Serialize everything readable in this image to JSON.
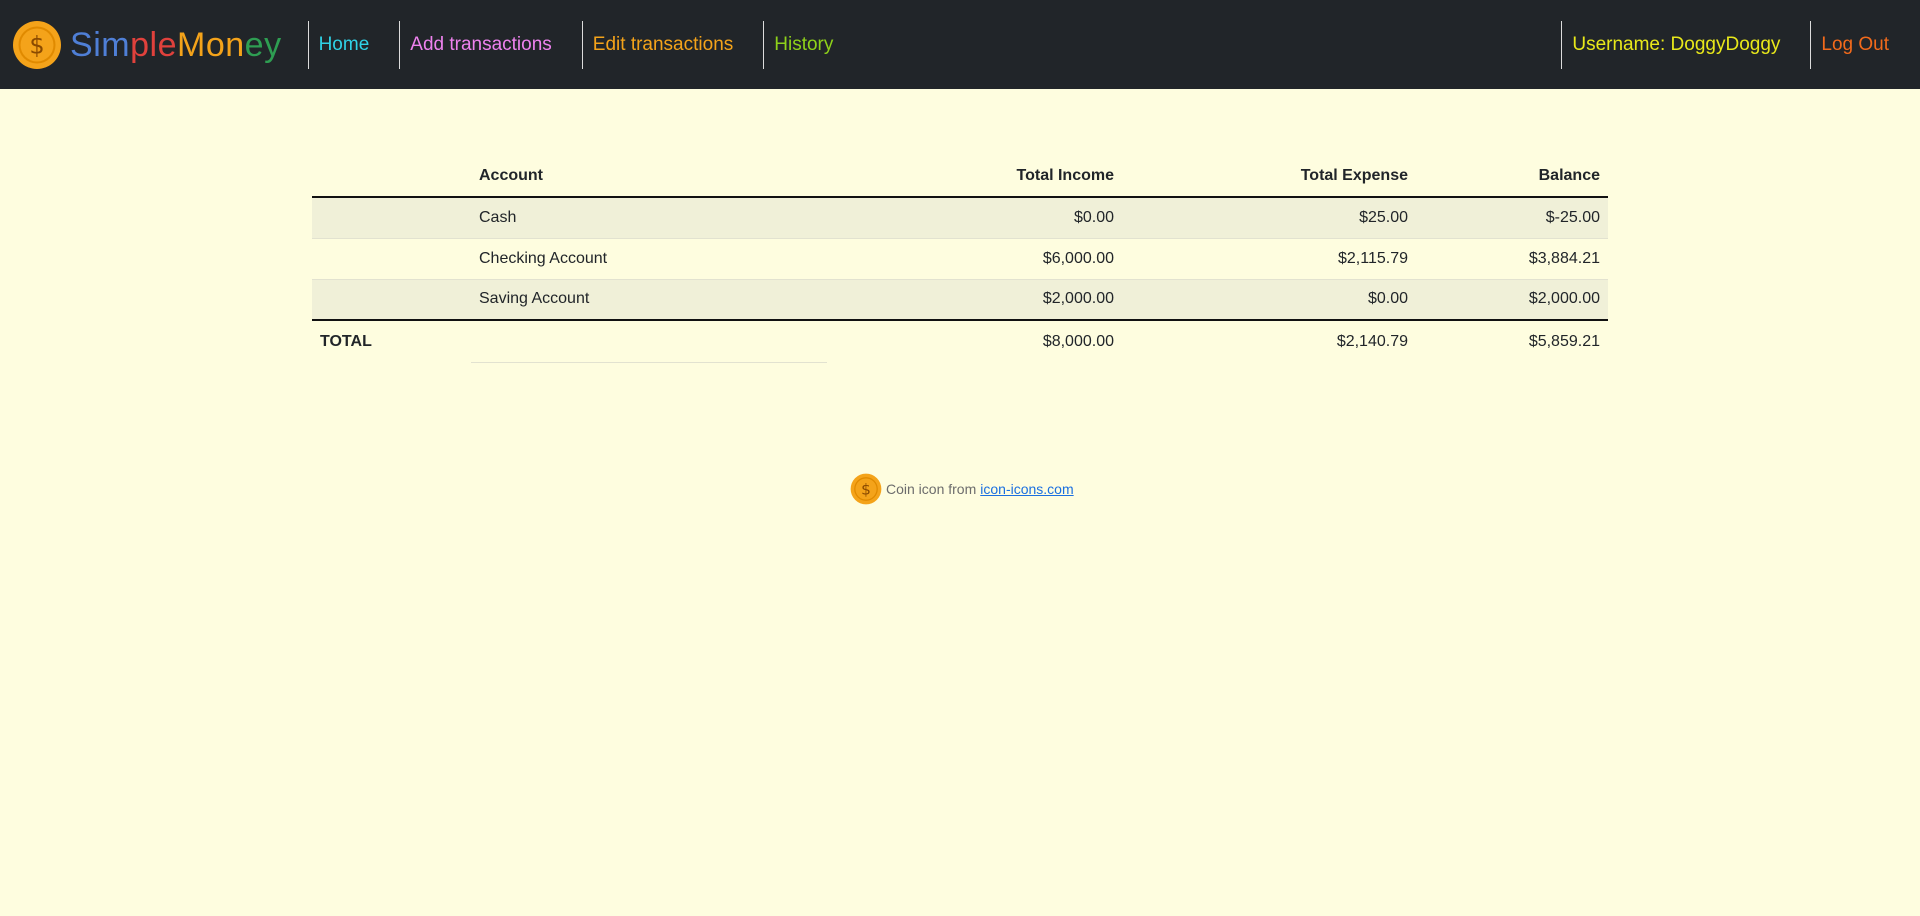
{
  "brand": {
    "letters": [
      {
        "ch": "S",
        "color": "#4f7fd6"
      },
      {
        "ch": "i",
        "color": "#4f7fd6"
      },
      {
        "ch": "m",
        "color": "#4f7fd6"
      },
      {
        "ch": "p",
        "color": "#e0413c"
      },
      {
        "ch": "l",
        "color": "#e0413c"
      },
      {
        "ch": "e",
        "color": "#e0413c"
      },
      {
        "ch": "M",
        "color": "#f4a31a"
      },
      {
        "ch": "o",
        "color": "#f4a31a"
      },
      {
        "ch": "n",
        "color": "#f4a31a"
      },
      {
        "ch": "e",
        "color": "#2e9e52"
      },
      {
        "ch": "y",
        "color": "#2e9e52"
      }
    ],
    "logo_icon": "coin-dollar-icon"
  },
  "nav": {
    "home": "Home",
    "add": "Add transactions",
    "edit": "Edit transactions",
    "history": "History",
    "username": "Username: DoggyDoggy",
    "logout": "Log Out"
  },
  "colors": {
    "nav_bg": "#212529",
    "page_bg": "#fefddf",
    "home": "#2fd2e6",
    "add": "#ee82ee",
    "edit": "#f4a31a",
    "history": "#8ed11a",
    "username": "#e8e81a",
    "logout": "#f26a1b"
  },
  "table": {
    "headers": {
      "label": "",
      "account": "Account",
      "income": "Total Income",
      "expense": "Total Expense",
      "balance": "Balance"
    },
    "rows": [
      {
        "account": "Cash",
        "income": "$0.00",
        "expense": "$25.00",
        "balance": "$-25.00"
      },
      {
        "account": "Checking Account",
        "income": "$6,000.00",
        "expense": "$2,115.79",
        "balance": "$3,884.21"
      },
      {
        "account": "Saving Account",
        "income": "$2,000.00",
        "expense": "$0.00",
        "balance": "$2,000.00"
      }
    ],
    "total": {
      "label": "TOTAL",
      "account": "",
      "income": "$8,000.00",
      "expense": "$2,140.79",
      "balance": "$5,859.21"
    }
  },
  "footer": {
    "icon": "coin-dollar-icon",
    "text": "Coin icon from",
    "link": "icon-icons.com"
  }
}
